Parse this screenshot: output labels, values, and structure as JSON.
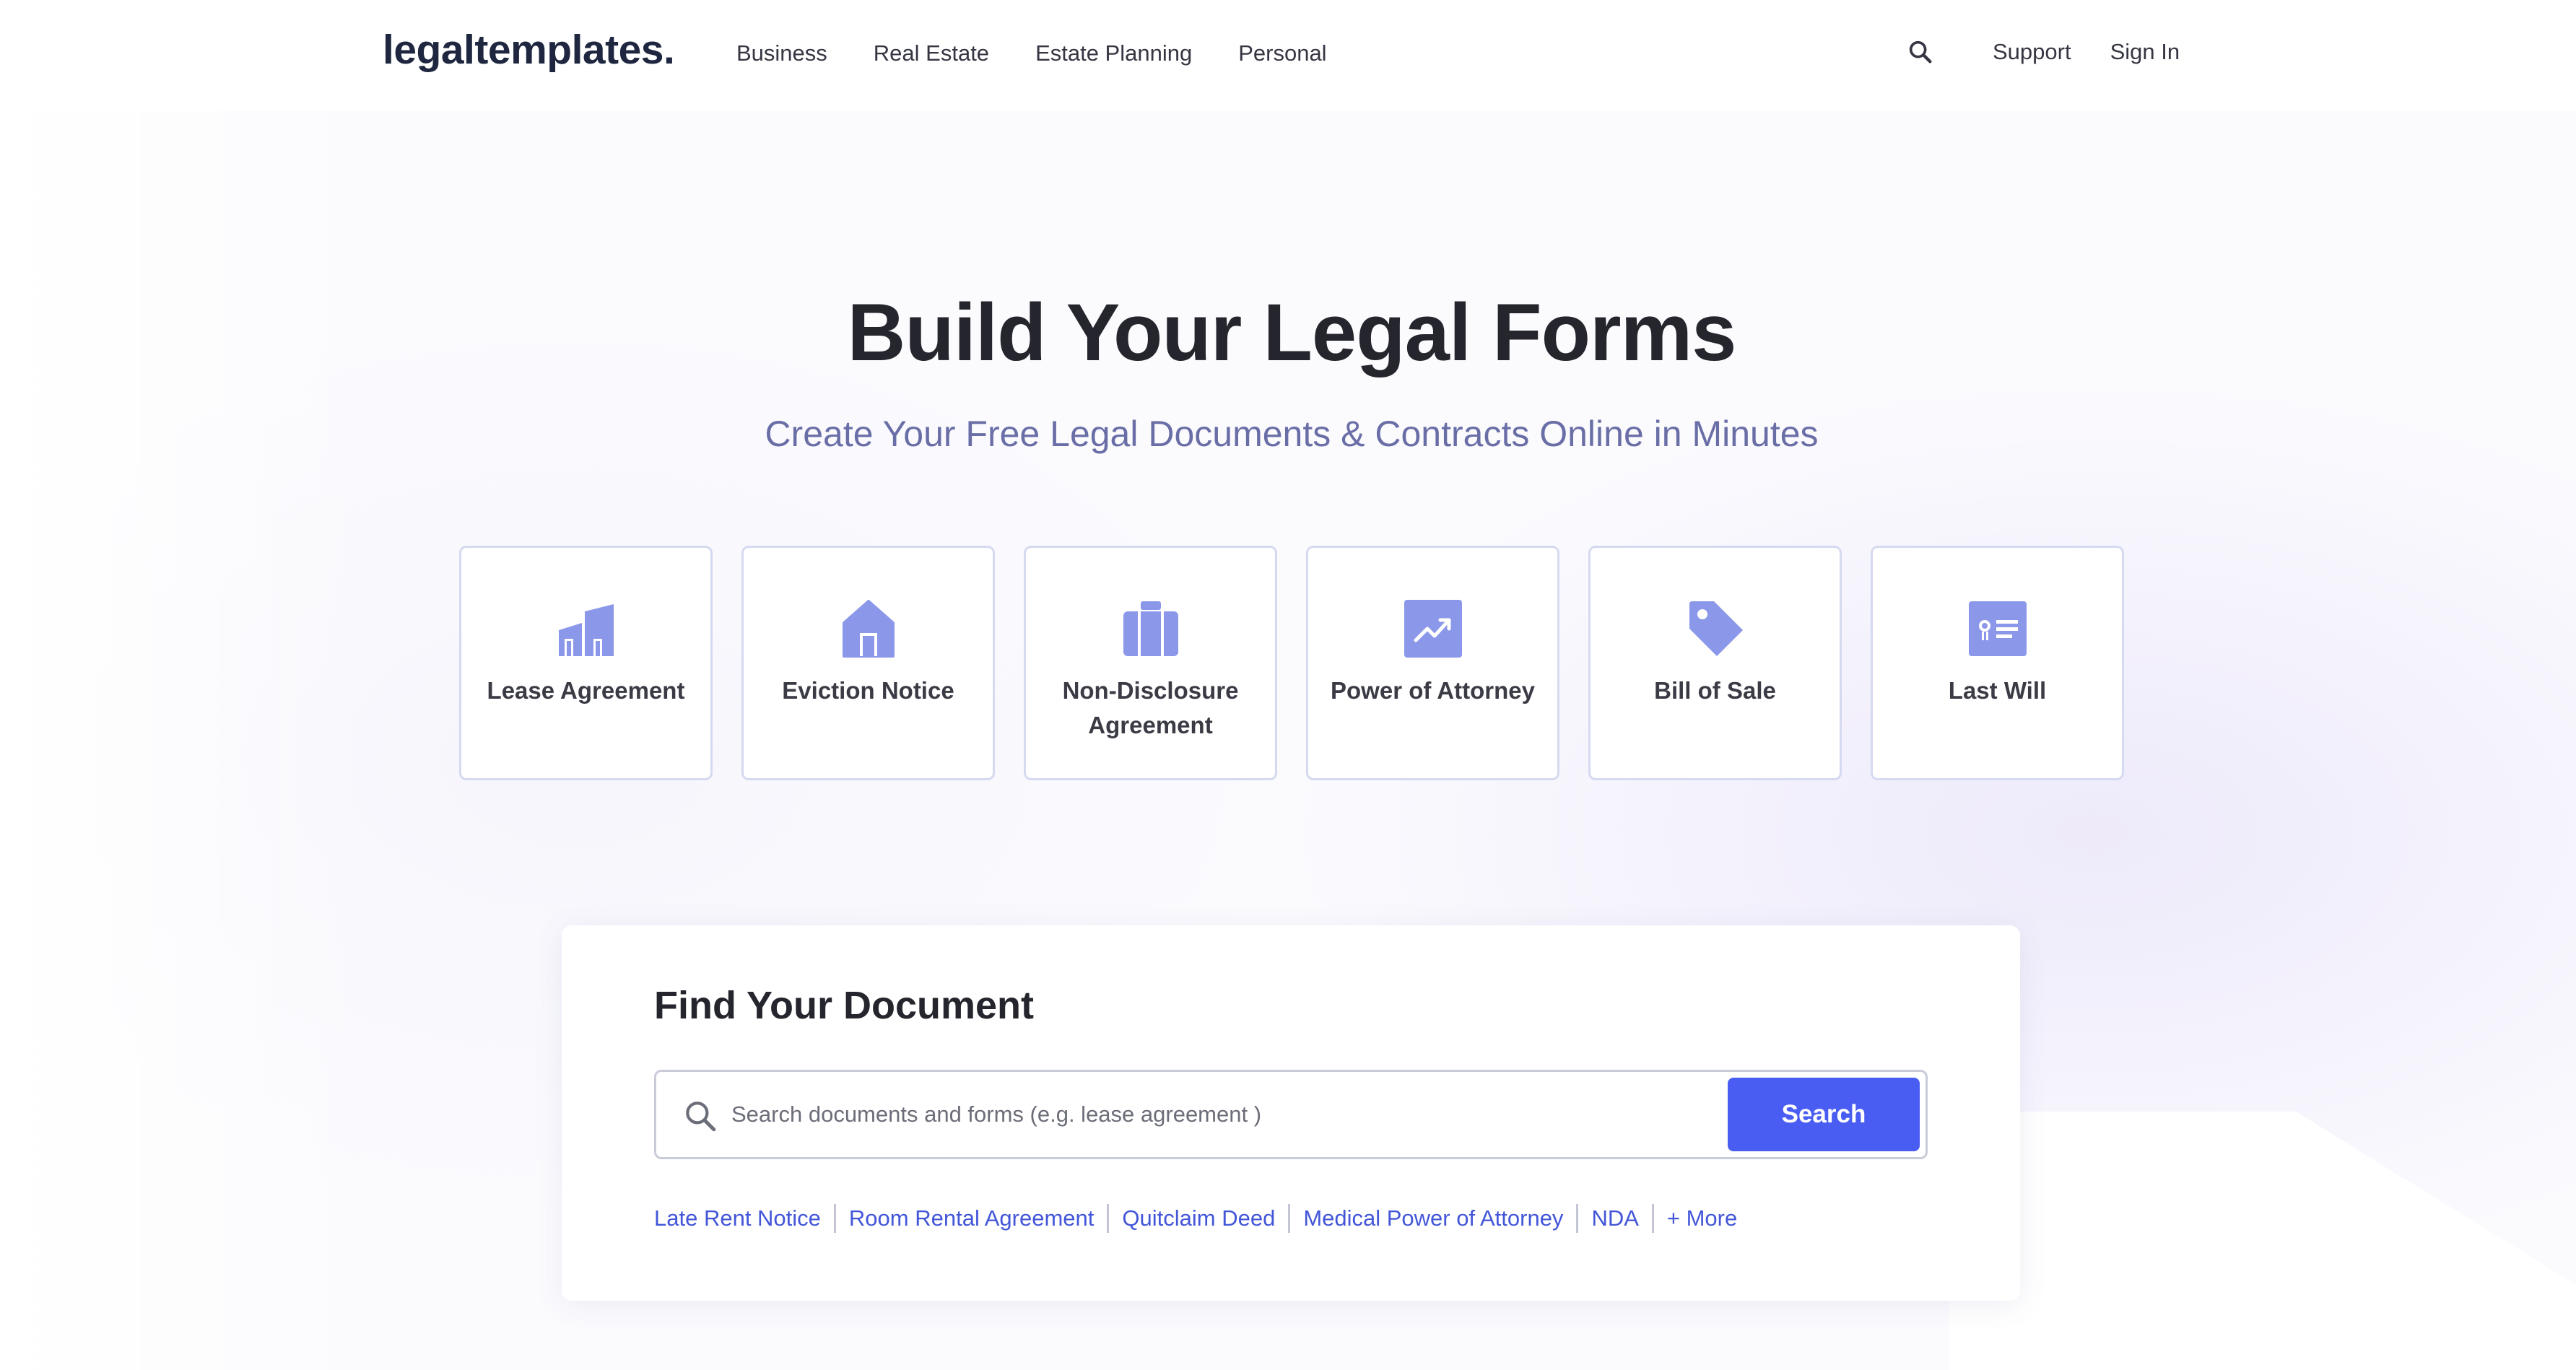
{
  "brand": {
    "logo": "legaltemplates."
  },
  "nav": {
    "items": [
      {
        "label": "Business"
      },
      {
        "label": "Real Estate"
      },
      {
        "label": "Estate Planning"
      },
      {
        "label": "Personal"
      }
    ],
    "search_icon": "search-icon",
    "support": "Support",
    "sign_in": "Sign In"
  },
  "hero": {
    "title": "Build Your Legal Forms",
    "subtitle": "Create Your Free Legal Documents & Contracts Online in Minutes"
  },
  "categories": [
    {
      "label": "Lease Agreement",
      "icon": "buildings-icon"
    },
    {
      "label": "Eviction Notice",
      "icon": "house-icon"
    },
    {
      "label": "Non-Disclosure Agreement",
      "icon": "briefcase-icon"
    },
    {
      "label": "Power of Attorney",
      "icon": "trend-chart-icon"
    },
    {
      "label": "Bill of Sale",
      "icon": "price-tag-icon"
    },
    {
      "label": "Last Will",
      "icon": "certificate-icon"
    }
  ],
  "find": {
    "title": "Find Your Document",
    "placeholder": "Search documents and forms (e.g. lease agreement )",
    "value": "",
    "button": "Search",
    "quick_links": [
      "Late Rent Notice",
      "Room Rental Agreement",
      "Quitclaim Deed",
      "Medical Power of Attorney",
      "NDA",
      "+ More"
    ]
  },
  "colors": {
    "accent": "#4a5df2",
    "icon": "#8b98ea",
    "link": "#4356d8",
    "subtitle": "#6a6ea6"
  }
}
